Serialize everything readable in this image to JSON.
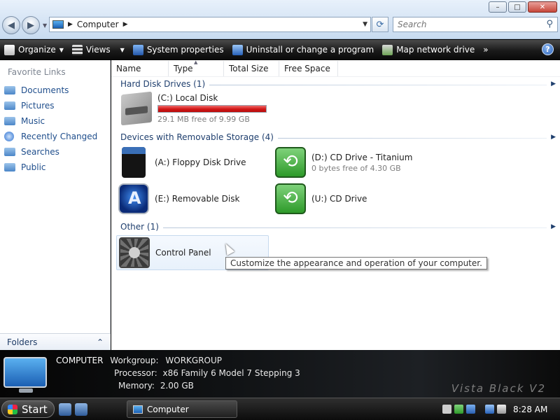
{
  "window": {
    "minimize_glyph": "–",
    "maximize_glyph": "□",
    "close_glyph": "✕"
  },
  "address": {
    "root_icon": "computer-icon",
    "breadcrumb": "Computer",
    "search_placeholder": "Search"
  },
  "toolbar": {
    "organize": "Organize",
    "views": "Views",
    "system_properties": "System properties",
    "uninstall": "Uninstall or change a program",
    "map_drive": "Map network drive",
    "more": "»",
    "help": "?"
  },
  "sidebar": {
    "heading": "Favorite Links",
    "items": [
      {
        "label": "Documents",
        "icon": "folder-icon"
      },
      {
        "label": "Pictures",
        "icon": "folder-icon"
      },
      {
        "label": "Music",
        "icon": "folder-icon"
      },
      {
        "label": "Recently Changed",
        "icon": "search-globe-icon"
      },
      {
        "label": "Searches",
        "icon": "folder-icon"
      },
      {
        "label": "Public",
        "icon": "folder-icon"
      }
    ],
    "folders_label": "Folders",
    "folders_chevron": "⌃"
  },
  "columns": [
    "Name",
    "Type",
    "Total Size",
    "Free Space"
  ],
  "groups": {
    "hard_disk": "Hard Disk Drives (1)",
    "removable": "Devices with Removable Storage (4)",
    "other": "Other (1)"
  },
  "drives": {
    "c": {
      "name": "(C:) Local Disk",
      "free": "29.1 MB free of 9.99 GB",
      "used_fraction": 0.997
    },
    "a": {
      "name": "(A:) Floppy Disk Drive"
    },
    "d": {
      "name": "(D:) CD Drive - Titanium",
      "free": "0 bytes free of 4.30 GB"
    },
    "e": {
      "name": "(E:) Removable Disk"
    },
    "u": {
      "name": "(U:) CD Drive"
    }
  },
  "other": {
    "control_panel": "Control Panel"
  },
  "tooltip": "Customize the appearance and operation of your computer.",
  "details": {
    "name": "COMPUTER",
    "workgroup_label": "Workgroup:",
    "workgroup_value": "WORKGROUP",
    "processor_label": "Processor:",
    "processor_value": "x86 Family 6 Model 7 Stepping 3",
    "memory_label": "Memory:",
    "memory_value": "2.00 GB",
    "brand": "Vista Black V2"
  },
  "taskbar": {
    "start": "Start",
    "task": "Computer",
    "clock": "8:28 AM"
  },
  "colors": {
    "accent": "#1f4e8c",
    "capacity_bar": "#d01616",
    "toolbar_bg": "#1a1a1a"
  }
}
